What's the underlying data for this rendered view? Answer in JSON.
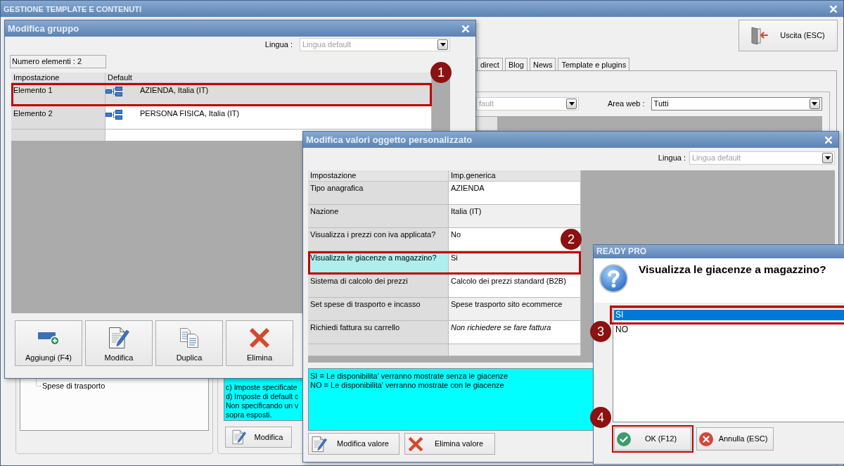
{
  "main_window": {
    "title": "GESTIONE TEMPLATE E CONTENUTI",
    "exit_button": "Uscita (ESC)",
    "tabs": [
      {
        "label": "direct",
        "selected": false
      },
      {
        "label": "Blog",
        "selected": false
      },
      {
        "label": "News",
        "selected": false
      },
      {
        "label": "Template e plugins",
        "selected": false
      }
    ],
    "language_select": {
      "value": "fault",
      "disabled": true
    },
    "area_select": {
      "label": "Area web :",
      "value": "Tutti",
      "disabled": false
    },
    "tree_items": [
      "Spese di trasporto"
    ],
    "notes": [
      "c) Imposte specificate",
      "d) Imposte di default c",
      "Non specificando un v",
      "sopra esposti."
    ],
    "edit_button": "Modifica"
  },
  "group_dialog": {
    "title": "Modifica gruppo",
    "language": {
      "label": "Lingua :",
      "value": "Lingua default",
      "disabled": true
    },
    "count": "Numero elementi : 2",
    "columns": [
      "Impostazione",
      "Default"
    ],
    "rows": [
      {
        "name": "Elemento 1",
        "value": "AZIENDA, Italia (IT)",
        "selected": true,
        "highlighted": true
      },
      {
        "name": "Elemento 2",
        "value": "PERSONA FISICA, Italia (IT)",
        "selected": false,
        "highlighted": false
      }
    ],
    "buttons": [
      {
        "kind": "add",
        "label": "Aggiungi (F4)"
      },
      {
        "kind": "edit",
        "label": "Modifica"
      },
      {
        "kind": "copy",
        "label": "Duplica"
      },
      {
        "kind": "delete",
        "label": "Elimina"
      }
    ],
    "callout": "1"
  },
  "values_dialog": {
    "title": "Modifica valori oggetto personalizzato",
    "language": {
      "label": "Lingua :",
      "value": "Lingua default",
      "disabled": true
    },
    "columns": [
      "Impostazione",
      "Imp.generica"
    ],
    "rows": [
      {
        "setting": "Tipo anagrafica",
        "value": "AZIENDA",
        "selected": false,
        "highlighted": false,
        "italic": false
      },
      {
        "setting": "Nazione",
        "value": "Italia (IT)",
        "selected": false,
        "highlighted": false,
        "italic": false
      },
      {
        "setting": "Visualizza i prezzi con iva applicata?",
        "value": "No",
        "selected": false,
        "highlighted": false,
        "italic": false
      },
      {
        "setting": "Visualizza le giacenze a magazzino?",
        "value": "Si",
        "selected": true,
        "highlighted": true,
        "italic": false
      },
      {
        "setting": "Sistema di calcolo dei prezzi",
        "value": "Calcolo dei prezzi standard (B2B)",
        "selected": false,
        "highlighted": false,
        "italic": false
      },
      {
        "setting": "Set spese di trasporto e incasso",
        "value": "Spese trasporto sito ecommerce",
        "selected": false,
        "highlighted": false,
        "italic": false
      },
      {
        "setting": "Richiedi fattura su carrello",
        "value": "Non richiedere se fare fattura",
        "selected": false,
        "highlighted": false,
        "italic": true
      }
    ],
    "description": [
      "SI = Le disponibilita' verranno mostrate senza le giacenze",
      "NO = Le disponibilita' verranno mostrate con le giacenze"
    ],
    "buttons": [
      {
        "kind": "edit",
        "label": "Modifica valore"
      },
      {
        "kind": "delete",
        "label": "Elimina valore"
      }
    ],
    "callout": "2"
  },
  "confirm_dialog": {
    "title": "READY PRO",
    "question": "Visualizza le giacenze a magazzino?",
    "options": [
      {
        "label": "SI",
        "selected": true,
        "highlighted": true
      },
      {
        "label": "NO",
        "selected": false,
        "highlighted": false
      }
    ],
    "options_callout": "3",
    "buttons": [
      {
        "kind": "ok",
        "label": "OK (F12)",
        "highlighted": true
      },
      {
        "kind": "cancel",
        "label": "Annulla (ESC)",
        "highlighted": false
      }
    ],
    "buttons_callout": "4"
  }
}
